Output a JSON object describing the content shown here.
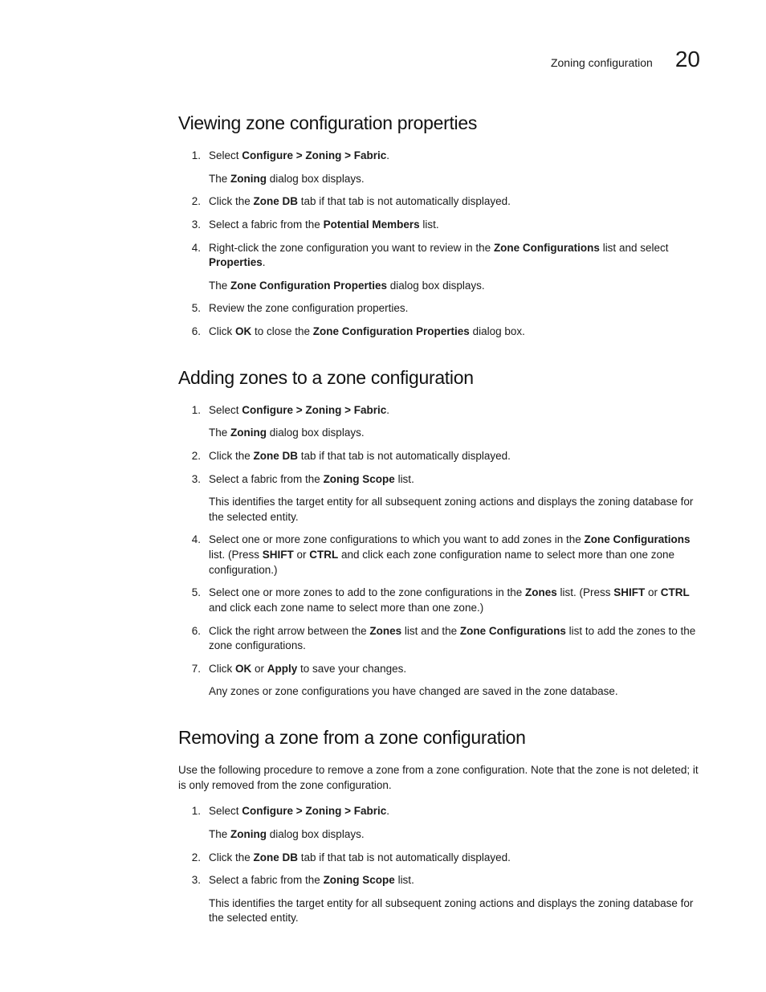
{
  "header": {
    "section": "Zoning configuration",
    "chapter": "20"
  },
  "sections": [
    {
      "title": "Viewing zone configuration properties",
      "intro": null,
      "steps": [
        {
          "parts": [
            {
              "t": "Select "
            },
            {
              "t": "Configure > Zoning > Fabric",
              "b": true
            },
            {
              "t": "."
            }
          ],
          "after": [
            [
              {
                "t": "The "
              },
              {
                "t": "Zoning",
                "b": true
              },
              {
                "t": " dialog box displays."
              }
            ]
          ]
        },
        {
          "parts": [
            {
              "t": "Click the "
            },
            {
              "t": "Zone DB",
              "b": true
            },
            {
              "t": " tab if that tab is not automatically displayed."
            }
          ]
        },
        {
          "parts": [
            {
              "t": "Select a fabric from the "
            },
            {
              "t": "Potential Members",
              "b": true
            },
            {
              "t": " list."
            }
          ]
        },
        {
          "parts": [
            {
              "t": "Right-click the zone configuration you want to review in the "
            },
            {
              "t": "Zone Configurations",
              "b": true
            },
            {
              "t": " list and select "
            },
            {
              "t": "Properties",
              "b": true
            },
            {
              "t": "."
            }
          ],
          "after": [
            [
              {
                "t": "The "
              },
              {
                "t": "Zone Configuration Properties",
                "b": true
              },
              {
                "t": " dialog box displays."
              }
            ]
          ]
        },
        {
          "parts": [
            {
              "t": "Review the zone configuration properties."
            }
          ]
        },
        {
          "parts": [
            {
              "t": "Click "
            },
            {
              "t": "OK",
              "b": true
            },
            {
              "t": " to close the "
            },
            {
              "t": "Zone Configuration Properties",
              "b": true
            },
            {
              "t": " dialog box."
            }
          ]
        }
      ]
    },
    {
      "title": "Adding zones to a zone configuration",
      "intro": null,
      "steps": [
        {
          "parts": [
            {
              "t": "Select "
            },
            {
              "t": "Configure > Zoning > Fabric",
              "b": true
            },
            {
              "t": "."
            }
          ],
          "after": [
            [
              {
                "t": "The "
              },
              {
                "t": "Zoning",
                "b": true
              },
              {
                "t": " dialog box displays."
              }
            ]
          ]
        },
        {
          "parts": [
            {
              "t": "Click the "
            },
            {
              "t": "Zone DB",
              "b": true
            },
            {
              "t": " tab if that tab is not automatically displayed."
            }
          ]
        },
        {
          "parts": [
            {
              "t": "Select a fabric from the "
            },
            {
              "t": "Zoning Scope",
              "b": true
            },
            {
              "t": " list."
            }
          ],
          "after": [
            [
              {
                "t": "This identifies the target entity for all subsequent zoning actions and displays the zoning database for the selected entity."
              }
            ]
          ]
        },
        {
          "parts": [
            {
              "t": "Select one or more zone configurations to which you want to add zones in the "
            },
            {
              "t": "Zone Configurations",
              "b": true
            },
            {
              "t": " list. (Press "
            },
            {
              "t": "SHIFT",
              "b": true
            },
            {
              "t": " or "
            },
            {
              "t": "CTRL",
              "b": true
            },
            {
              "t": " and click each zone configuration name to select more than one zone configuration.)"
            }
          ]
        },
        {
          "parts": [
            {
              "t": "Select one or more zones to add to the zone configurations in the "
            },
            {
              "t": "Zones",
              "b": true
            },
            {
              "t": " list. (Press "
            },
            {
              "t": "SHIFT",
              "b": true
            },
            {
              "t": " or "
            },
            {
              "t": "CTRL",
              "b": true
            },
            {
              "t": " and click each zone name to select more than one zone.)"
            }
          ]
        },
        {
          "parts": [
            {
              "t": "Click the right arrow between the "
            },
            {
              "t": "Zones",
              "b": true
            },
            {
              "t": " list and the "
            },
            {
              "t": "Zone Configurations",
              "b": true
            },
            {
              "t": " list to add the zones to the zone configurations."
            }
          ]
        },
        {
          "parts": [
            {
              "t": "Click "
            },
            {
              "t": "OK",
              "b": true
            },
            {
              "t": " or "
            },
            {
              "t": "Apply",
              "b": true
            },
            {
              "t": " to save your changes."
            }
          ],
          "after": [
            [
              {
                "t": "Any zones or zone configurations you have changed are saved in the zone database."
              }
            ]
          ]
        }
      ]
    },
    {
      "title": "Removing a zone from a zone configuration",
      "intro": [
        {
          "t": "Use the following procedure to remove a zone from a zone configuration. Note that the zone is not deleted; it is only removed from the zone configuration."
        }
      ],
      "steps": [
        {
          "parts": [
            {
              "t": "Select "
            },
            {
              "t": "Configure > Zoning > Fabric",
              "b": true
            },
            {
              "t": "."
            }
          ],
          "after": [
            [
              {
                "t": "The "
              },
              {
                "t": "Zoning",
                "b": true
              },
              {
                "t": " dialog box displays."
              }
            ]
          ]
        },
        {
          "parts": [
            {
              "t": "Click the "
            },
            {
              "t": "Zone DB",
              "b": true
            },
            {
              "t": " tab if that tab is not automatically displayed."
            }
          ]
        },
        {
          "parts": [
            {
              "t": "Select a fabric from the "
            },
            {
              "t": "Zoning Scope",
              "b": true
            },
            {
              "t": " list."
            }
          ],
          "after": [
            [
              {
                "t": "This identifies the target entity for all subsequent zoning actions and displays the zoning database for the selected entity."
              }
            ]
          ]
        }
      ]
    }
  ]
}
